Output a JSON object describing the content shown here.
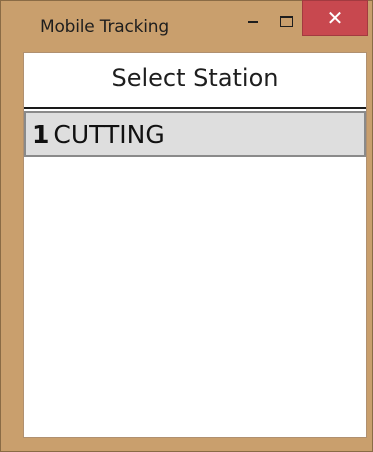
{
  "window": {
    "title": "Mobile Tracking",
    "frame_color": "#c99f6d",
    "close_color": "#c8484f",
    "close_glyph": "✕"
  },
  "header": {
    "title": "Select Station"
  },
  "stations": [
    {
      "number": "1",
      "name": "CUTTING",
      "selected": true
    }
  ]
}
